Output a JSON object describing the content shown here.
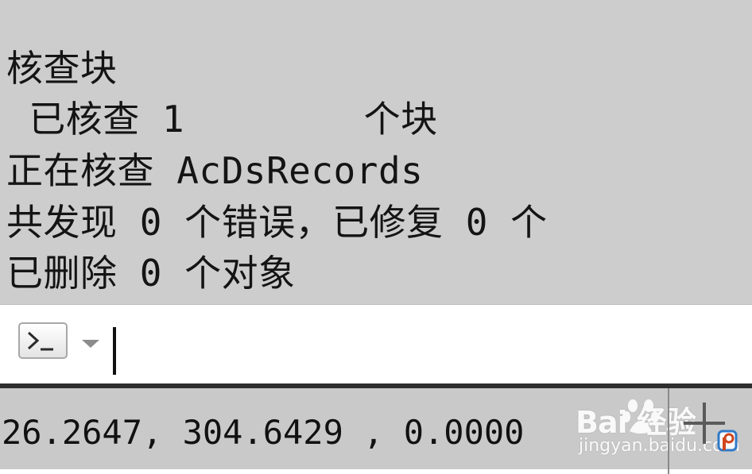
{
  "history": {
    "lines": [
      "核查块",
      " 已核查 1        个块",
      "正在核查 AcDsRecords",
      "共发现 0 个错误，已修复 0 个",
      "已删除 0 个对象"
    ]
  },
  "command_line": {
    "value": "",
    "button_icon": "command-prompt-icon",
    "dropdown_icon": "chevron-down-icon"
  },
  "status": {
    "coordinates": "26.2647, 304.6429 , 0.0000",
    "grid_icon": "grid-display-icon"
  },
  "watermark": {
    "brand": "Bai  经验",
    "url": "jingyan.baidu.com"
  },
  "colors": {
    "history_bg": "#cdcdcd",
    "status_bg": "#c9c9c9",
    "text": "#141414"
  }
}
